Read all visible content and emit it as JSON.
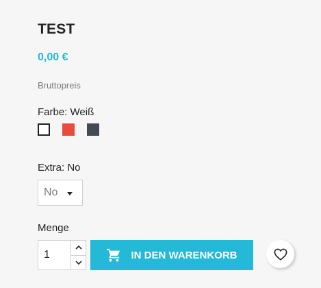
{
  "product": {
    "title": "TEST",
    "price": "0,00 €",
    "tax_label": "Bruttopreis"
  },
  "variants": {
    "color": {
      "label": "Farbe: Weiß",
      "swatches": [
        {
          "name": "Weiß",
          "hex": "#ffffff",
          "selected": true
        },
        {
          "name": "Rot",
          "hex": "#e84c3d",
          "selected": false
        },
        {
          "name": "Grau",
          "hex": "#434a54",
          "selected": false
        }
      ]
    },
    "extra": {
      "label": "Extra: No",
      "selected_value": "No"
    }
  },
  "quantity": {
    "label": "Menge",
    "value": "1"
  },
  "actions": {
    "add_to_cart_label": "IN DEN WARENKORB",
    "cart_icon": "shopping-cart-icon",
    "wishlist_icon": "heart-outline-icon"
  },
  "colors": {
    "accent": "#24b9d7",
    "text": "#232323",
    "muted": "#7a7a7a",
    "background": "#f6f6f6"
  }
}
